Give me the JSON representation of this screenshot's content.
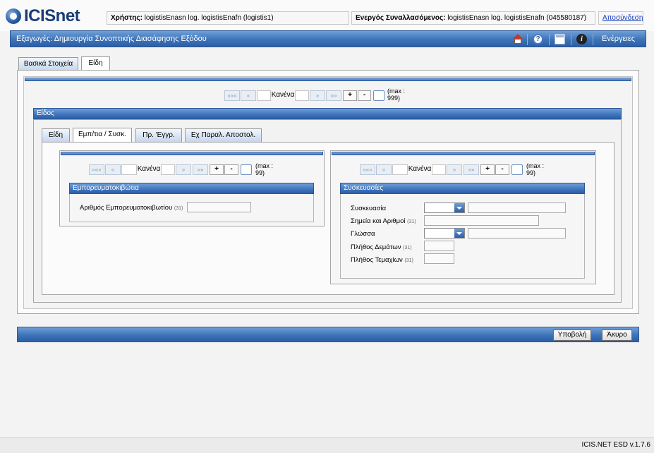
{
  "app": {
    "logo_text": "ICISnet",
    "version": "ICIS.NET ESD v.1.7.6"
  },
  "header": {
    "user_label": "Χρήστης:",
    "user_value": "logistisEnasn log. logistisEnafn (logistis1)",
    "trader_label": "Ενεργός Συναλλασόμενος:",
    "trader_value": "logistisEnasn log. logistisEnafn (045580187)",
    "logout": "Αποσύνδεση"
  },
  "titlebar": {
    "title": "Εξαγωγές: Δημιουργία Συνοπτικής Διασάφησης Εξόδου",
    "actions": "Ενέργειες"
  },
  "main_tabs": [
    {
      "label": "Βασικά Στοιχεία"
    },
    {
      "label": "Είδη"
    }
  ],
  "navigator": {
    "first": "«««",
    "prev": "«",
    "next": "»",
    "last": "»»",
    "value": "Κανένα",
    "add": "+",
    "remove": "-",
    "max": "(max : 999)"
  },
  "item_section": {
    "title": "Είδος"
  },
  "item_tabs": [
    {
      "label": "Είδη"
    },
    {
      "label": "Εμπ/τια / Συσκ."
    },
    {
      "label": "Πρ. 'Εγγρ."
    },
    {
      "label": "Εχ Παραλ. Αποστολ."
    }
  ],
  "containers": {
    "navigator": {
      "value": "Κανένα",
      "max": "(max : 99)"
    },
    "title": "Εμπορευματοκιβώτια",
    "field_label": "Αριθμός Εμπορευματοκιβωτίου",
    "field_code": "(31)",
    "field_value": ""
  },
  "packages": {
    "navigator": {
      "value": "Κανένα",
      "max": "(max : 99)"
    },
    "title": "Συσκευασίες",
    "fields": [
      {
        "label": "Συσκευασία",
        "code": ""
      },
      {
        "label": "Σημεία και Αριθμοί",
        "code": "(31)"
      },
      {
        "label": "Γλώσσα",
        "code": ""
      },
      {
        "label": "Πλήθος Δεμάτων",
        "code": "(31)"
      },
      {
        "label": "Πλήθος Τεμαχίων",
        "code": "(31)"
      }
    ]
  },
  "buttons": {
    "submit": "Υποβολή",
    "cancel": "Άκυρο"
  }
}
